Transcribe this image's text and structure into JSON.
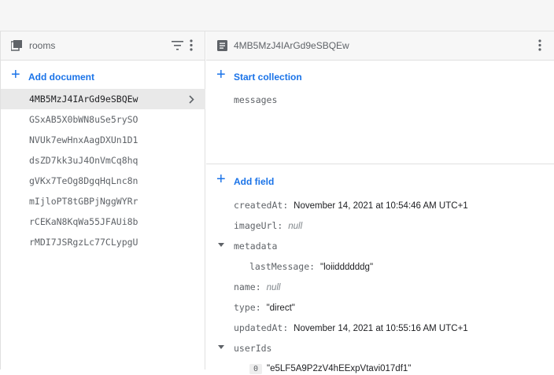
{
  "collection_panel": {
    "title": "rooms",
    "add_document_label": "Add document",
    "documents": [
      "4MB5MzJ4IArGd9eSBQEw",
      "GSxAB5X0bWN8uSe5rySO",
      "NVUk7ewHnxAagDXUn1D1",
      "dsZD7kk3uJ4OnVmCq8hq",
      "gVKx7TeOg8DgqHqLnc8n",
      "mIjloPT8tGBPjNggWYRr",
      "rCEKaN8KqWa55JFAUi8b",
      "rMDI7JSRgzLc77CLypgU"
    ]
  },
  "document_panel": {
    "title": "4MB5MzJ4IArGd9eSBQEw",
    "start_collection_label": "Start collection",
    "subcollections": [
      "messages"
    ],
    "add_field_label": "Add field",
    "fields": {
      "createdAt": {
        "key": "createdAt",
        "value": "November 14, 2021 at 10:54:46 AM UTC+1"
      },
      "imageUrl": {
        "key": "imageUrl",
        "value": "null"
      },
      "metadata": {
        "key": "metadata"
      },
      "lastMessage": {
        "key": "lastMessage",
        "value": "\"loiiddddddg\""
      },
      "name": {
        "key": "name",
        "value": "null"
      },
      "type": {
        "key": "type",
        "value": "\"direct\""
      },
      "updatedAt": {
        "key": "updatedAt",
        "value": "November 14, 2021 at 10:55:16 AM UTC+1"
      },
      "userIds": {
        "key": "userIds"
      },
      "userIds_0": {
        "index": "0",
        "value": "\"e5LF5A9P2zV4hEExpVtavi017df1\""
      }
    }
  },
  "colors": {
    "accent": "#1a73e8",
    "selected_row": "#e9e9e9",
    "header_bg": "#f7f7f7"
  }
}
